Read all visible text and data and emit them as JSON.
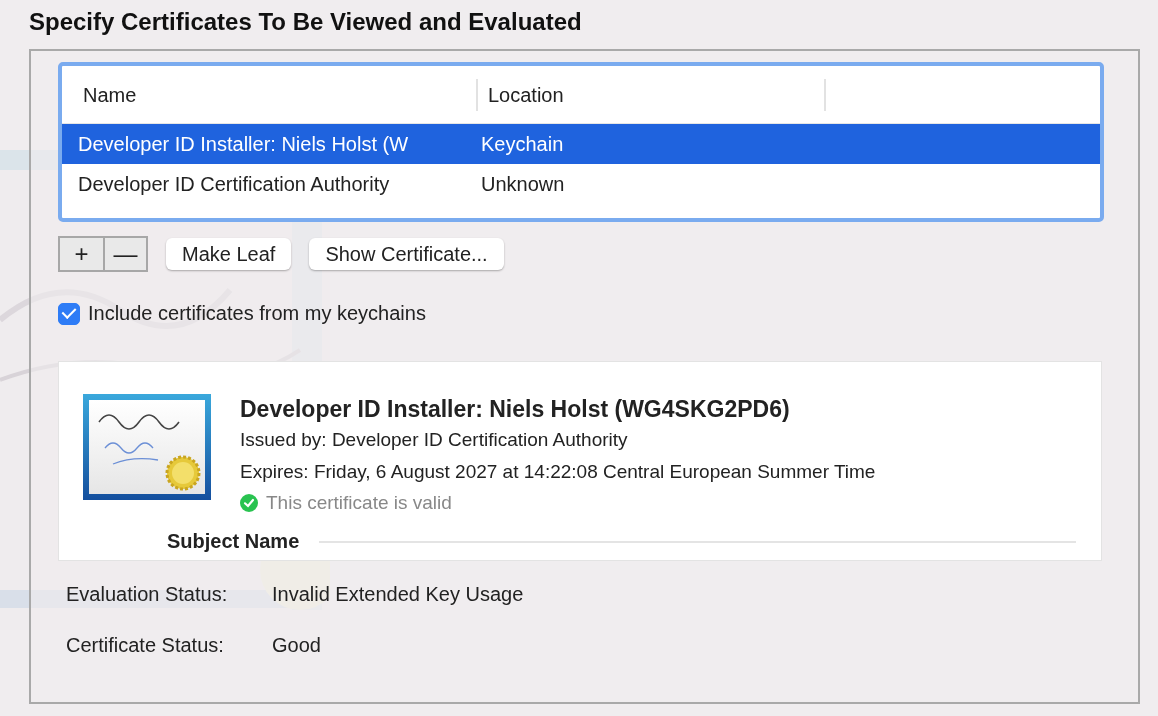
{
  "title": "Specify Certificates To Be Viewed and Evaluated",
  "table": {
    "columns": [
      "Name",
      "Location"
    ],
    "rows": [
      {
        "name": "Developer ID Installer: Niels Holst (W",
        "location": "Keychain",
        "selected": true
      },
      {
        "name": "Developer ID Certification Authority",
        "location": "Unknown",
        "selected": false
      }
    ]
  },
  "buttons": {
    "add": "+",
    "remove": "—",
    "make_leaf": "Make Leaf",
    "show_certificate": "Show Certificate..."
  },
  "include_keychains": {
    "label": "Include certificates from my keychains",
    "checked": true
  },
  "certificate": {
    "title": "Developer ID Installer: Niels Holst (WG4SKG2PD6)",
    "issued_by": "Issued by: Developer ID Certification Authority",
    "expires": "Expires: Friday, 6 August 2027 at 14:22:08 Central European Summer Time",
    "valid": true,
    "validity": "This certificate is valid",
    "section": "Subject Name"
  },
  "status": [
    {
      "label": "Evaluation Status:",
      "value": "Invalid Extended Key Usage"
    },
    {
      "label": "Certificate Status:",
      "value": "Good"
    }
  ]
}
